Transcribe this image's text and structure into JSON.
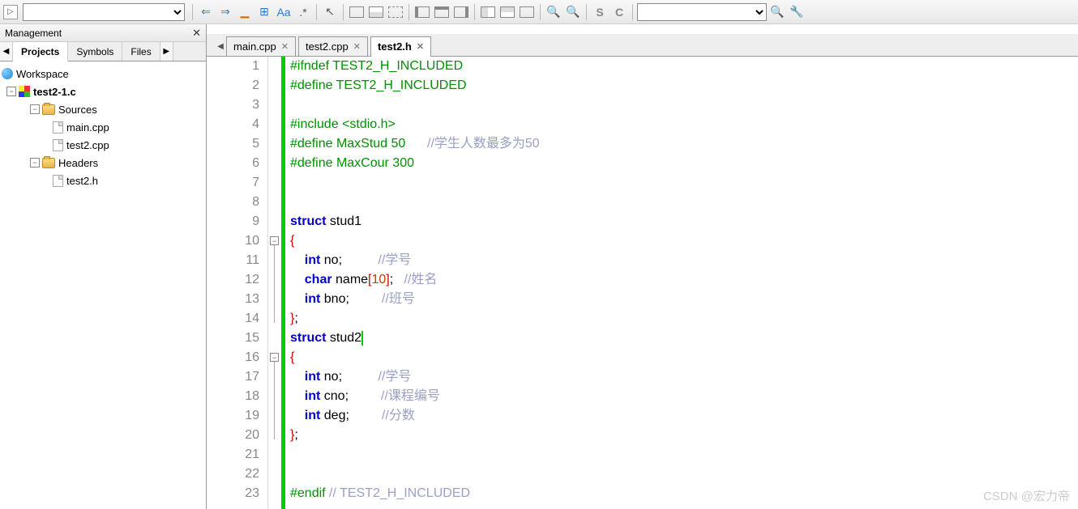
{
  "toolbar": {
    "letters": {
      "s": "S",
      "c": "C",
      "aa": "Aa"
    }
  },
  "mgmt": {
    "title": "Management",
    "tabs": [
      "Projects",
      "Symbols",
      "Files"
    ],
    "activeTab": 0,
    "tree": {
      "workspace": "Workspace",
      "project": "test2-1.c",
      "sources": "Sources",
      "headers": "Headers",
      "files": {
        "main": "main.cpp",
        "test2c": "test2.cpp",
        "test2h": "test2.h"
      }
    }
  },
  "editor": {
    "tabs": [
      {
        "label": "main.cpp",
        "active": false
      },
      {
        "label": "test2.cpp",
        "active": false
      },
      {
        "label": "test2.h",
        "active": true
      }
    ],
    "lines": [
      {
        "n": 1,
        "seg": [
          {
            "c": "pp",
            "t": "#ifndef TEST2_H_INCLUDED"
          }
        ]
      },
      {
        "n": 2,
        "seg": [
          {
            "c": "pp",
            "t": "#define TEST2_H_INCLUDED"
          }
        ]
      },
      {
        "n": 3,
        "seg": [
          {
            "c": "",
            "t": ""
          }
        ]
      },
      {
        "n": 4,
        "seg": [
          {
            "c": "pp",
            "t": "#include <stdio.h>"
          }
        ]
      },
      {
        "n": 5,
        "seg": [
          {
            "c": "pp",
            "t": "#define MaxStud 50      "
          },
          {
            "c": "cm",
            "t": "//学生人数最多为50"
          }
        ]
      },
      {
        "n": 6,
        "seg": [
          {
            "c": "pp",
            "t": "#define MaxCour 300"
          }
        ]
      },
      {
        "n": 7,
        "seg": [
          {
            "c": "",
            "t": ""
          }
        ]
      },
      {
        "n": 8,
        "seg": [
          {
            "c": "",
            "t": ""
          }
        ]
      },
      {
        "n": 9,
        "seg": [
          {
            "c": "kw",
            "t": "struct"
          },
          {
            "c": "",
            "t": " stud1"
          }
        ]
      },
      {
        "n": 10,
        "seg": [
          {
            "c": "br",
            "t": "{"
          }
        ],
        "fold": true
      },
      {
        "n": 11,
        "seg": [
          {
            "c": "",
            "t": "    "
          },
          {
            "c": "k2",
            "t": "int"
          },
          {
            "c": "",
            "t": " no;          "
          },
          {
            "c": "cm",
            "t": "//学号"
          }
        ]
      },
      {
        "n": 12,
        "seg": [
          {
            "c": "",
            "t": "    "
          },
          {
            "c": "k2",
            "t": "char"
          },
          {
            "c": "",
            "t": " name"
          },
          {
            "c": "br",
            "t": "["
          },
          {
            "c": "num",
            "t": "10"
          },
          {
            "c": "br",
            "t": "]"
          },
          {
            "c": "",
            "t": ";   "
          },
          {
            "c": "cm",
            "t": "//姓名"
          }
        ]
      },
      {
        "n": 13,
        "seg": [
          {
            "c": "",
            "t": "    "
          },
          {
            "c": "k2",
            "t": "int"
          },
          {
            "c": "",
            "t": " bno;         "
          },
          {
            "c": "cm",
            "t": "//班号"
          }
        ]
      },
      {
        "n": 14,
        "seg": [
          {
            "c": "br",
            "t": "}"
          },
          {
            "c": "",
            "t": ";"
          }
        ]
      },
      {
        "n": 15,
        "seg": [
          {
            "c": "kw",
            "t": "struct"
          },
          {
            "c": "",
            "t": " stud2"
          }
        ],
        "cursor": true
      },
      {
        "n": 16,
        "seg": [
          {
            "c": "br",
            "t": "{"
          }
        ],
        "fold": true
      },
      {
        "n": 17,
        "seg": [
          {
            "c": "",
            "t": "    "
          },
          {
            "c": "k2",
            "t": "int"
          },
          {
            "c": "",
            "t": " no;          "
          },
          {
            "c": "cm",
            "t": "//学号"
          }
        ]
      },
      {
        "n": 18,
        "seg": [
          {
            "c": "",
            "t": "    "
          },
          {
            "c": "k2",
            "t": "int"
          },
          {
            "c": "",
            "t": " cno;         "
          },
          {
            "c": "cm",
            "t": "//课程编号"
          }
        ]
      },
      {
        "n": 19,
        "seg": [
          {
            "c": "",
            "t": "    "
          },
          {
            "c": "k2",
            "t": "int"
          },
          {
            "c": "",
            "t": " deg;         "
          },
          {
            "c": "cm",
            "t": "//分数"
          }
        ]
      },
      {
        "n": 20,
        "seg": [
          {
            "c": "br",
            "t": "}"
          },
          {
            "c": "",
            "t": ";"
          }
        ]
      },
      {
        "n": 21,
        "seg": [
          {
            "c": "",
            "t": ""
          }
        ]
      },
      {
        "n": 22,
        "seg": [
          {
            "c": "",
            "t": ""
          }
        ]
      },
      {
        "n": 23,
        "seg": [
          {
            "c": "pp",
            "t": "#endif "
          },
          {
            "c": "cm",
            "t": "// TEST2_H_INCLUDED"
          }
        ]
      }
    ]
  },
  "watermark": "CSDN @宏力帝"
}
